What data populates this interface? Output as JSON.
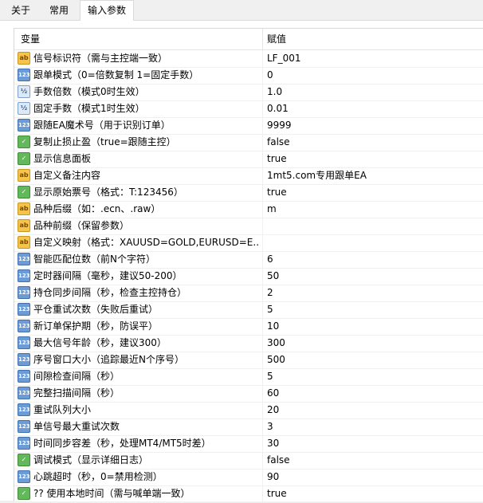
{
  "tabs": [
    {
      "label": "关于",
      "active": false
    },
    {
      "label": "常用",
      "active": false
    },
    {
      "label": "输入参数",
      "active": true
    }
  ],
  "table": {
    "headers": {
      "name": "变量",
      "value": "赋值"
    },
    "rows": [
      {
        "icon": "ab",
        "name": "信号标识符（需与主控端一致）",
        "value": "LF_001"
      },
      {
        "icon": "123",
        "name": "跟单模式（0=倍数复制 1=固定手数）",
        "value": "0"
      },
      {
        "icon": "half",
        "name": "手数倍数（模式0时生效）",
        "value": "1.0"
      },
      {
        "icon": "half",
        "name": "固定手数（模式1时生效）",
        "value": "0.01"
      },
      {
        "icon": "123",
        "name": "跟随EA魔术号（用于识别订单）",
        "value": "9999"
      },
      {
        "icon": "bool",
        "name": "复制止损止盈（true=跟随主控）",
        "value": "false"
      },
      {
        "icon": "bool",
        "name": "显示信息面板",
        "value": "true"
      },
      {
        "icon": "ab",
        "name": "自定义备注内容",
        "value": "1mt5.com专用跟单EA"
      },
      {
        "icon": "bool",
        "name": "显示原始票号（格式：T:123456）",
        "value": "true"
      },
      {
        "icon": "ab",
        "name": "品种后缀（如：.ecn、.raw）",
        "value": "m"
      },
      {
        "icon": "ab",
        "name": "品种前缀（保留参数）",
        "value": ""
      },
      {
        "icon": "ab",
        "name": "自定义映射（格式：XAUUSD=GOLD,EURUSD=E...",
        "value": ""
      },
      {
        "icon": "123",
        "name": "智能匹配位数（前N个字符）",
        "value": "6"
      },
      {
        "icon": "123",
        "name": "定时器间隔（毫秒，建议50-200）",
        "value": "50"
      },
      {
        "icon": "123",
        "name": "持仓同步间隔（秒，检查主控持仓）",
        "value": "2"
      },
      {
        "icon": "123",
        "name": "平仓重试次数（失败后重试）",
        "value": "5"
      },
      {
        "icon": "123",
        "name": "新订单保护期（秒，防误平）",
        "value": "10"
      },
      {
        "icon": "123",
        "name": "最大信号年龄（秒，建议300）",
        "value": "300"
      },
      {
        "icon": "123",
        "name": "序号窗口大小（追踪最近N个序号）",
        "value": "500"
      },
      {
        "icon": "123",
        "name": "间隙检查间隔（秒）",
        "value": "5"
      },
      {
        "icon": "123",
        "name": "完整扫描间隔（秒）",
        "value": "60"
      },
      {
        "icon": "123",
        "name": "重试队列大小",
        "value": "20"
      },
      {
        "icon": "123",
        "name": "单信号最大重试次数",
        "value": "3"
      },
      {
        "icon": "123",
        "name": "时间同步容差（秒，处理MT4/MT5时差）",
        "value": "30"
      },
      {
        "icon": "bool",
        "name": "调试模式（显示详细日志）",
        "value": "false"
      },
      {
        "icon": "123",
        "name": "心跳超时（秒，0=禁用检测）",
        "value": "90"
      },
      {
        "icon": "bool",
        "name": "?? 使用本地时间（需与喊单端一致）",
        "value": "true"
      }
    ]
  },
  "icon_glyphs": {
    "ab": "ab",
    "123": "123",
    "half": "½",
    "bool": "✓"
  }
}
